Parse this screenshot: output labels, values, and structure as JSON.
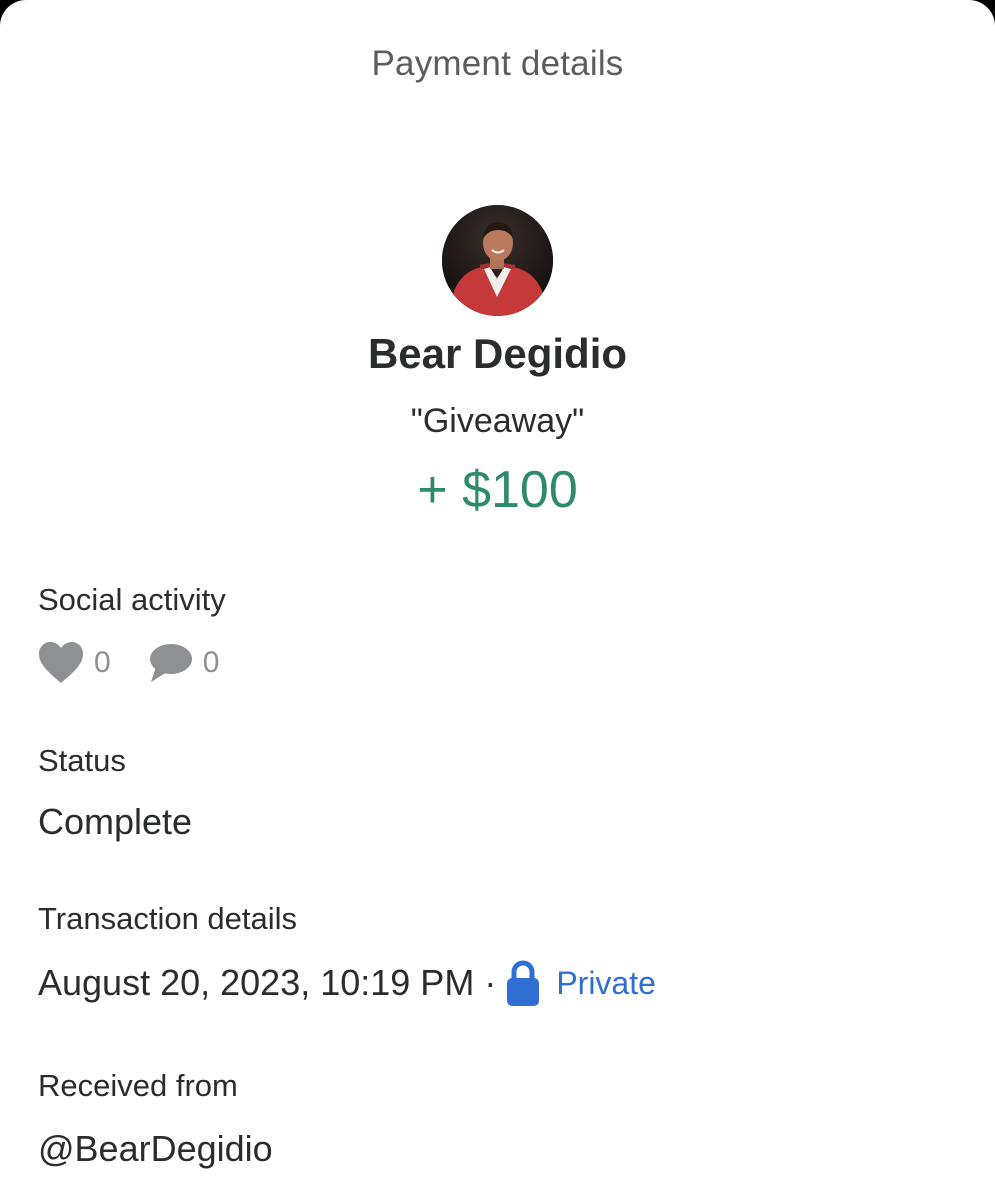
{
  "header": {
    "title": "Payment details"
  },
  "payer": {
    "avatar_alt": "avatar",
    "name": "Bear Degidio",
    "note": "\"Giveaway\"",
    "amount": "+ $100"
  },
  "social": {
    "label": "Social activity",
    "likes": {
      "icon": "heart-icon",
      "count": "0"
    },
    "comments": {
      "icon": "comment-icon",
      "count": "0"
    }
  },
  "status": {
    "label": "Status",
    "value": "Complete"
  },
  "transaction": {
    "label": "Transaction details",
    "datetime": "August 20, 2023, 10:19 PM",
    "separator": "·",
    "privacy_icon": "lock-icon",
    "privacy": "Private"
  },
  "received_from": {
    "label": "Received from",
    "value": "@BearDegidio"
  },
  "colors": {
    "amount_green": "#2e8a6c",
    "privacy_blue": "#2f6fd3",
    "muted_gray": "#8e9094",
    "text_dark": "#2b2c2e"
  }
}
